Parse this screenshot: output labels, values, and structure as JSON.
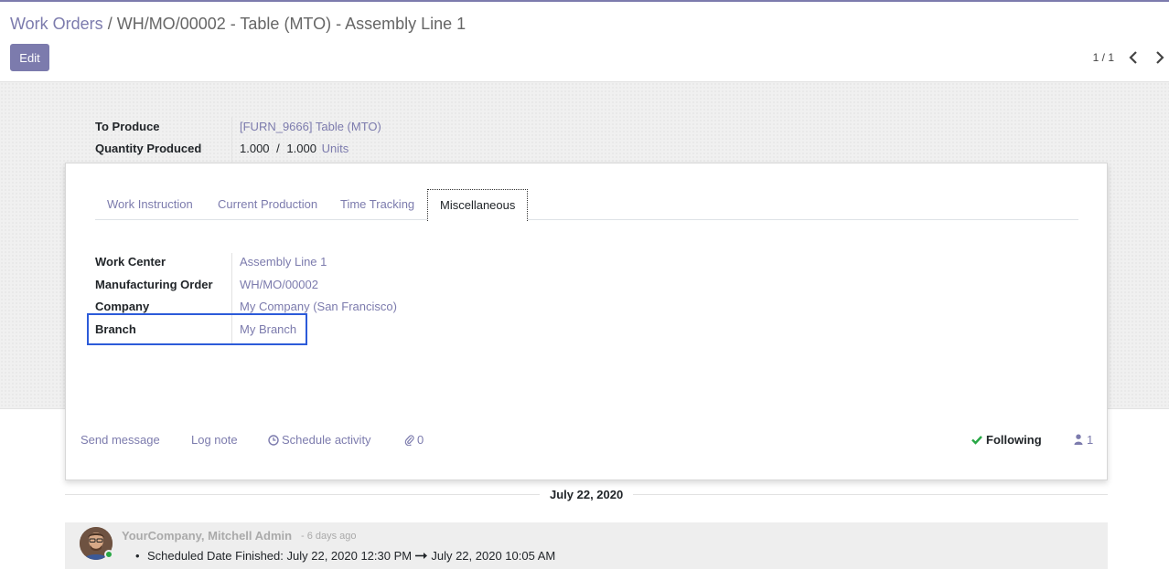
{
  "breadcrumb": {
    "parent": "Work Orders",
    "separator": "/",
    "current": "WH/MO/00002 - Table (MTO) - Assembly Line 1"
  },
  "toolbar": {
    "edit_label": "Edit"
  },
  "pager": {
    "value": "1 / 1"
  },
  "header_fields": {
    "to_produce_label": "To Produce",
    "to_produce_value": "[FURN_9666] Table (MTO)",
    "qty_label": "Quantity Produced",
    "qty_done": "1.000",
    "qty_sep": "/",
    "qty_total": "1.000",
    "qty_uom": "Units"
  },
  "tabs": [
    {
      "label": "Work Instruction"
    },
    {
      "label": "Current Production"
    },
    {
      "label": "Time Tracking"
    },
    {
      "label": "Miscellaneous",
      "active": true
    }
  ],
  "misc": {
    "work_center_label": "Work Center",
    "work_center_value": "Assembly Line 1",
    "mo_label": "Manufacturing Order",
    "mo_value": "WH/MO/00002",
    "company_label": "Company",
    "company_value": "My Company (San Francisco)",
    "branch_label": "Branch",
    "branch_value": "My Branch"
  },
  "chatter": {
    "send_message": "Send message",
    "log_note": "Log note",
    "schedule_activity": "Schedule activity",
    "attachments_count": "0",
    "following": "Following",
    "followers_count": "1"
  },
  "thread": {
    "date": "July 22, 2020",
    "message": {
      "author": "YourCompany, Mitchell Admin",
      "time": "- 6 days ago",
      "change_field": "Scheduled Date Finished:",
      "old_value": "July 22, 2020 12:30 PM",
      "new_value": "July 22, 2020 10:05 AM"
    }
  },
  "colors": {
    "brand": "#7c7bad",
    "highlight": "#2c5bd9",
    "following_check": "#28a745",
    "presence": "#28a745"
  }
}
